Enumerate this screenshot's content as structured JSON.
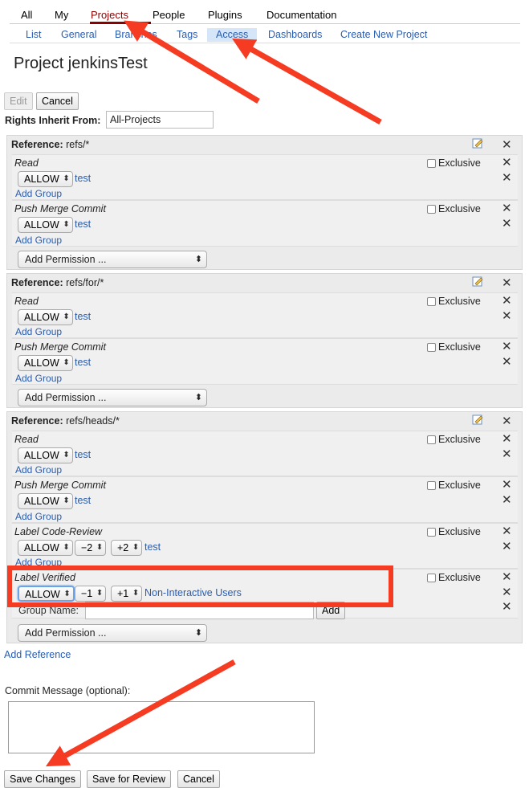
{
  "topmenu": {
    "items": [
      "All",
      "My",
      "Projects",
      "People",
      "Plugins",
      "Documentation"
    ]
  },
  "submenu": {
    "items": [
      "List",
      "General",
      "Branches",
      "Tags",
      "Access",
      "Dashboards",
      "Create New Project"
    ]
  },
  "page": {
    "title": "Project jenkinsTest"
  },
  "toolbar": {
    "edit": "Edit",
    "cancel": "Cancel"
  },
  "rights": {
    "label": "Rights Inherit From:",
    "value": "All-Projects"
  },
  "common": {
    "reference_label": "Reference:",
    "exclusive": "Exclusive",
    "add_group": "Add Group",
    "add_permission": "Add Permission ...",
    "allow": "ALLOW",
    "group_name_label": "Group Name:",
    "add_button": "Add",
    "close": "✕"
  },
  "references": [
    {
      "path": "refs/*",
      "permissions": [
        {
          "name": "Read",
          "group": "test"
        },
        {
          "name": "Push Merge Commit",
          "group": "test"
        }
      ]
    },
    {
      "path": "refs/for/*",
      "permissions": [
        {
          "name": "Read",
          "group": "test"
        },
        {
          "name": "Push Merge Commit",
          "group": "test"
        }
      ]
    },
    {
      "path": "refs/heads/*",
      "permissions": [
        {
          "name": "Read",
          "group": "test"
        },
        {
          "name": "Push Merge Commit",
          "group": "test"
        },
        {
          "name": "Label Code-Review",
          "min": "−2",
          "max": "+2",
          "group": "test"
        },
        {
          "name": "Label Verified",
          "min": "−1",
          "max": "+1",
          "group": "Non-Interactive Users"
        }
      ]
    }
  ],
  "add_reference": "Add Reference",
  "commit": {
    "label": "Commit Message (optional):",
    "placeholder": ""
  },
  "footer": {
    "save": "Save Changes",
    "save_review": "Save for Review",
    "cancel": "Cancel"
  },
  "annotations": {
    "arrow_color": "#f53b22",
    "box_color": "#f53b22"
  }
}
